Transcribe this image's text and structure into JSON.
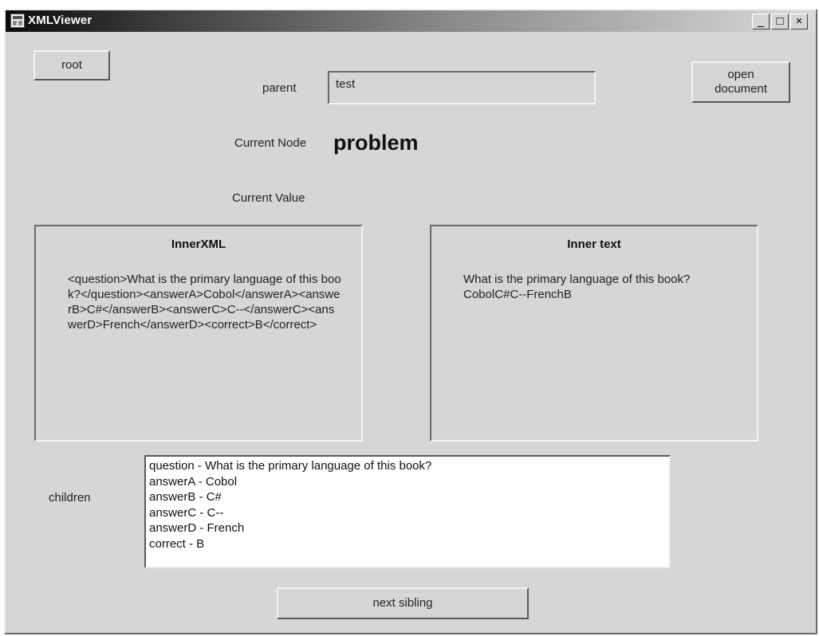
{
  "window": {
    "title": "XMLViewer",
    "controls": {
      "minimize": "_",
      "maximize": "□",
      "close": "×"
    }
  },
  "buttons": {
    "root": "root",
    "open_document": "open\ndocument",
    "next_sibling": "next sibling"
  },
  "parent": {
    "label": "parent",
    "value": "test"
  },
  "current_node": {
    "label": "Current Node",
    "value": "problem"
  },
  "current_value": {
    "label": "Current Value"
  },
  "inner_xml": {
    "title": "InnerXML",
    "text": "<question>What is the primary language of this book?</question><answerA>Cobol</answerA><answerB>C#</answerB><answerC>C--</answerC><answerD>French</answerD><correct>B</correct>"
  },
  "inner_text": {
    "title": "Inner text",
    "text": "What is the primary language of this book?CobolC#C--FrenchB"
  },
  "children": {
    "label": "children",
    "items": [
      "question - What is the primary language of this book?",
      "answerA - Cobol",
      "answerB - C#",
      "answerC - C--",
      "answerD - French",
      "correct - B"
    ]
  }
}
